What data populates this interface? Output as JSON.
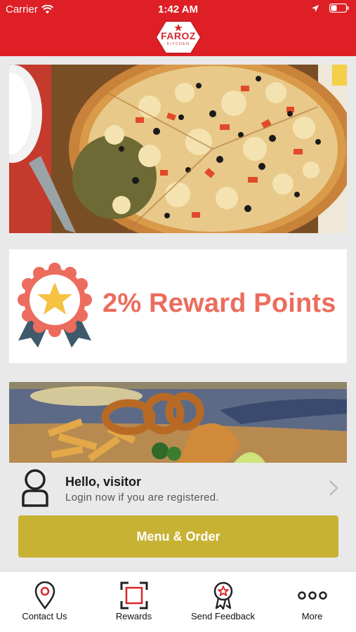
{
  "status_bar": {
    "carrier": "Carrier",
    "time": "1:42 AM",
    "icons": [
      "wifi-icon",
      "location-arrow-icon",
      "battery-icon"
    ]
  },
  "header": {
    "logo_name": "FAROZ",
    "logo_sub": "KITCHEN",
    "background_color": "#de1f26"
  },
  "banners": {
    "pizza_image": "pizza-banner",
    "reward": {
      "text": "2% Reward Points",
      "icon": "award-ribbon-icon",
      "text_color": "#ec6c5d"
    },
    "food_image": "fish-and-chips-banner"
  },
  "visitor": {
    "greeting": "Hello, visitor",
    "subtitle": "Login now if you are registered."
  },
  "menu_button": {
    "label": "Menu & Order",
    "color": "#c7b234"
  },
  "tabs": [
    {
      "label": "Contact Us",
      "icon": "location-pin-icon"
    },
    {
      "label": "Rewards",
      "icon": "qr-scan-icon"
    },
    {
      "label": "Send Feedback",
      "icon": "badge-star-icon"
    },
    {
      "label": "More",
      "icon": "more-dots-icon"
    }
  ]
}
